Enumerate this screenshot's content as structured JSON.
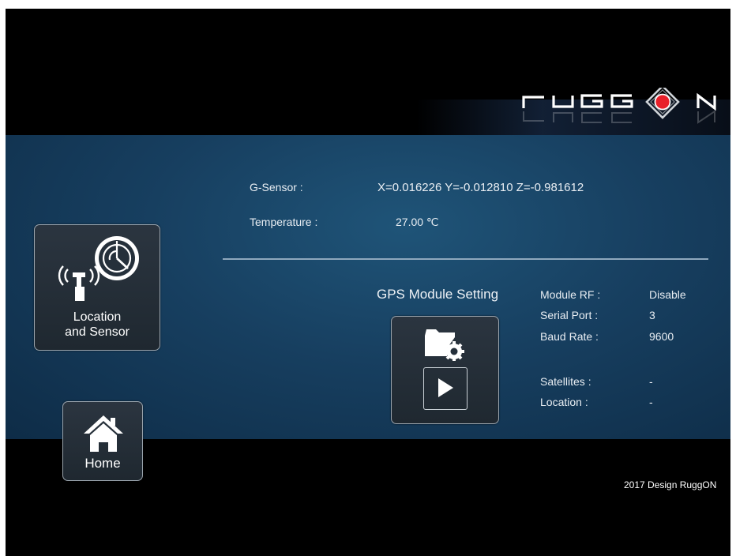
{
  "brand": {
    "name": "RUGGON"
  },
  "sensors": {
    "g_sensor_label": "G-Sensor :",
    "g_sensor_value": "X=0.016226 Y=-0.012810 Z=-0.981612",
    "temperature_label": "Temperature :",
    "temperature_value": "27.00 ℃"
  },
  "nav": {
    "location_tile": {
      "line1": "Location",
      "line2": "and Sensor",
      "icon": "antenna-radar-icon"
    },
    "home_tile": {
      "label": "Home",
      "icon": "home-icon"
    }
  },
  "gps": {
    "title": "GPS Module Setting",
    "settings_icon": "folder-gear-icon",
    "play_icon": "play-icon",
    "module_rf_label": "Module RF :",
    "module_rf_value": "Disable",
    "serial_port_label": "Serial Port :",
    "serial_port_value": "3",
    "baud_rate_label": "Baud Rate :",
    "baud_rate_value": "9600",
    "satellites_label": "Satellites :",
    "satellites_value": "-",
    "location_label": "Location :",
    "location_value": "-"
  },
  "footer": {
    "copyright": "2017 Design RuggON"
  },
  "colors": {
    "background": "#000000",
    "panel": "#173f60",
    "accent_red": "#e8202a",
    "tile_border": "#9aa4ad",
    "text": "#e9eef3"
  }
}
